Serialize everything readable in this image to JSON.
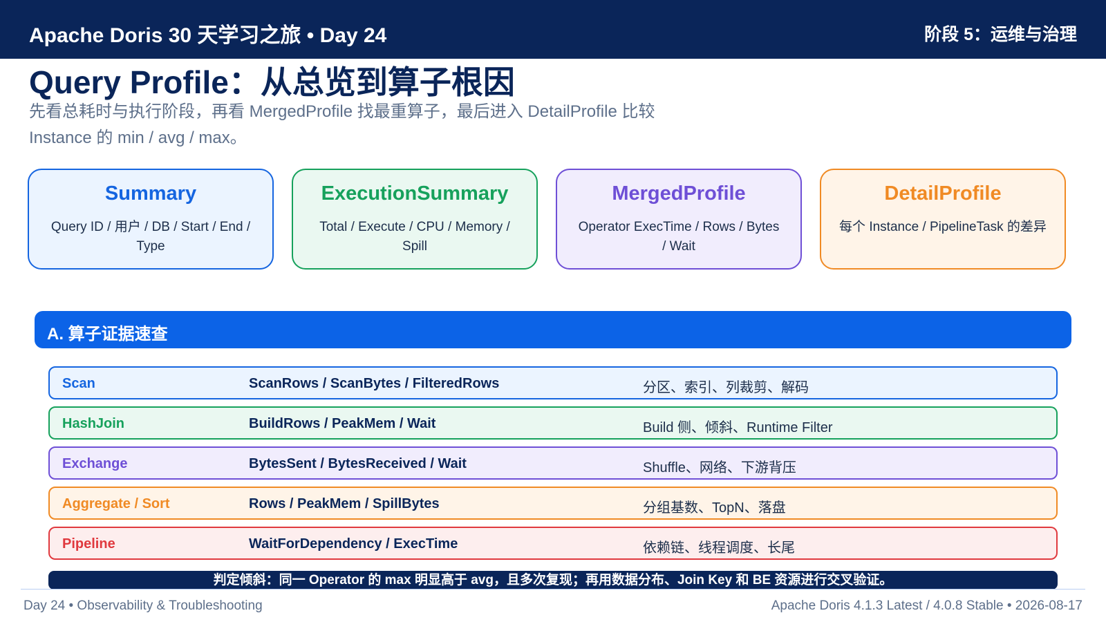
{
  "header": {
    "title": "Apache Doris 30 天学习之旅 • Day 24",
    "stage": "阶段 5：运维与治理"
  },
  "page": {
    "title": "Query Profile：从总览到算子根因",
    "subtitle": "先看总耗时与执行阶段，再看 MergedProfile 找最重算子，最后进入 DetailProfile 比较 Instance 的 min / avg / max。"
  },
  "cards": [
    {
      "title": "Summary",
      "desc": "Query ID / 用户 / DB / Start / End / Type",
      "color": "#1565e0",
      "bg": "#ebf4ff"
    },
    {
      "title": "ExecutionSummary",
      "desc": "Total / Execute / CPU / Memory / Spill",
      "color": "#16a15c",
      "bg": "#eaf8f1"
    },
    {
      "title": "MergedProfile",
      "desc": "Operator ExecTime / Rows / Bytes / Wait",
      "color": "#6e4fd6",
      "bg": "#f1edfd"
    },
    {
      "title": "DetailProfile",
      "desc": "每个 Instance / PipelineTask 的差异",
      "color": "#f08a24",
      "bg": "#fff4e8"
    }
  ],
  "section": {
    "label": "A. 算子证据速查"
  },
  "rows": [
    {
      "name": "Scan",
      "metrics": "ScanRows / ScanBytes / FilteredRows",
      "causes": "分区、索引、列裁剪、解码",
      "color": "#1565e0",
      "bg": "#ebf4ff"
    },
    {
      "name": "HashJoin",
      "metrics": "BuildRows / PeakMem / Wait",
      "causes": "Build 侧、倾斜、Runtime Filter",
      "color": "#16a15c",
      "bg": "#eaf8f1"
    },
    {
      "name": "Exchange",
      "metrics": "BytesSent / BytesReceived / Wait",
      "causes": "Shuffle、网络、下游背压",
      "color": "#6e4fd6",
      "bg": "#f1edfd"
    },
    {
      "name": "Aggregate / Sort",
      "metrics": "Rows / PeakMem / SpillBytes",
      "causes": "分组基数、TopN、落盘",
      "color": "#f08a24",
      "bg": "#fff4e8"
    },
    {
      "name": "Pipeline",
      "metrics": "WaitForDependency / ExecTime",
      "causes": "依赖链、线程调度、长尾",
      "color": "#e0393e",
      "bg": "#fdeeee"
    }
  ],
  "note": "判定倾斜：同一 Operator 的 max 明显高于 avg，且多次复现；再用数据分布、Join Key 和 BE 资源进行交叉验证。",
  "footer": {
    "left": "Day 24 • Observability & Troubleshooting",
    "right": "Apache Doris 4.1.3 Latest / 4.0.8 Stable • 2026-08-17"
  }
}
